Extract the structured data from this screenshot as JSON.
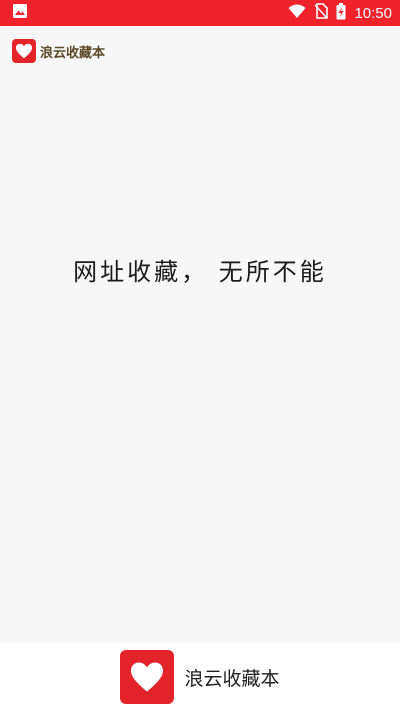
{
  "status_bar": {
    "time": "10:50",
    "background_color": "#f0222c",
    "icons": [
      "image-notification-icon",
      "wifi-icon",
      "no-sim-icon",
      "battery-charging-icon"
    ]
  },
  "header": {
    "app_name": "浪云收藏本",
    "logo_icon": "heart-icon"
  },
  "main": {
    "slogan": "网址收藏， 无所不能"
  },
  "footer": {
    "app_name": "浪云收藏本",
    "logo_icon": "heart-icon",
    "brand_color": "#e3242b"
  }
}
